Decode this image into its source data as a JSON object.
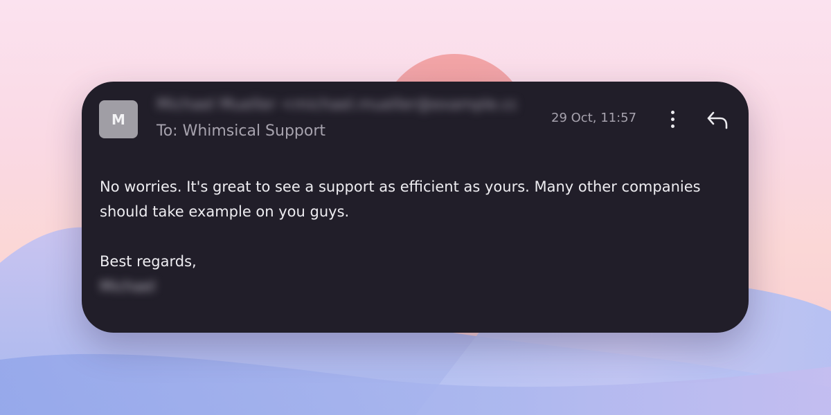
{
  "email": {
    "avatar_initial": "M",
    "sender": "Michael Mueller <michael.mueller@example.com>",
    "recipient": "To: Whimsical Support",
    "timestamp": "29 Oct, 11:57",
    "icons": {
      "more": "more-vertical-icon",
      "reply": "reply-icon"
    },
    "body": {
      "paragraph": "No worries. It's great to see a support as efficient as yours. Many other companies should take example on you guys.",
      "signoff": "Best regards,",
      "signature": "Michael"
    }
  },
  "colors": {
    "card": "#211e29",
    "text": "#eeedf1",
    "muted": "#a7a3ae",
    "avatar": "#a09ea5"
  }
}
